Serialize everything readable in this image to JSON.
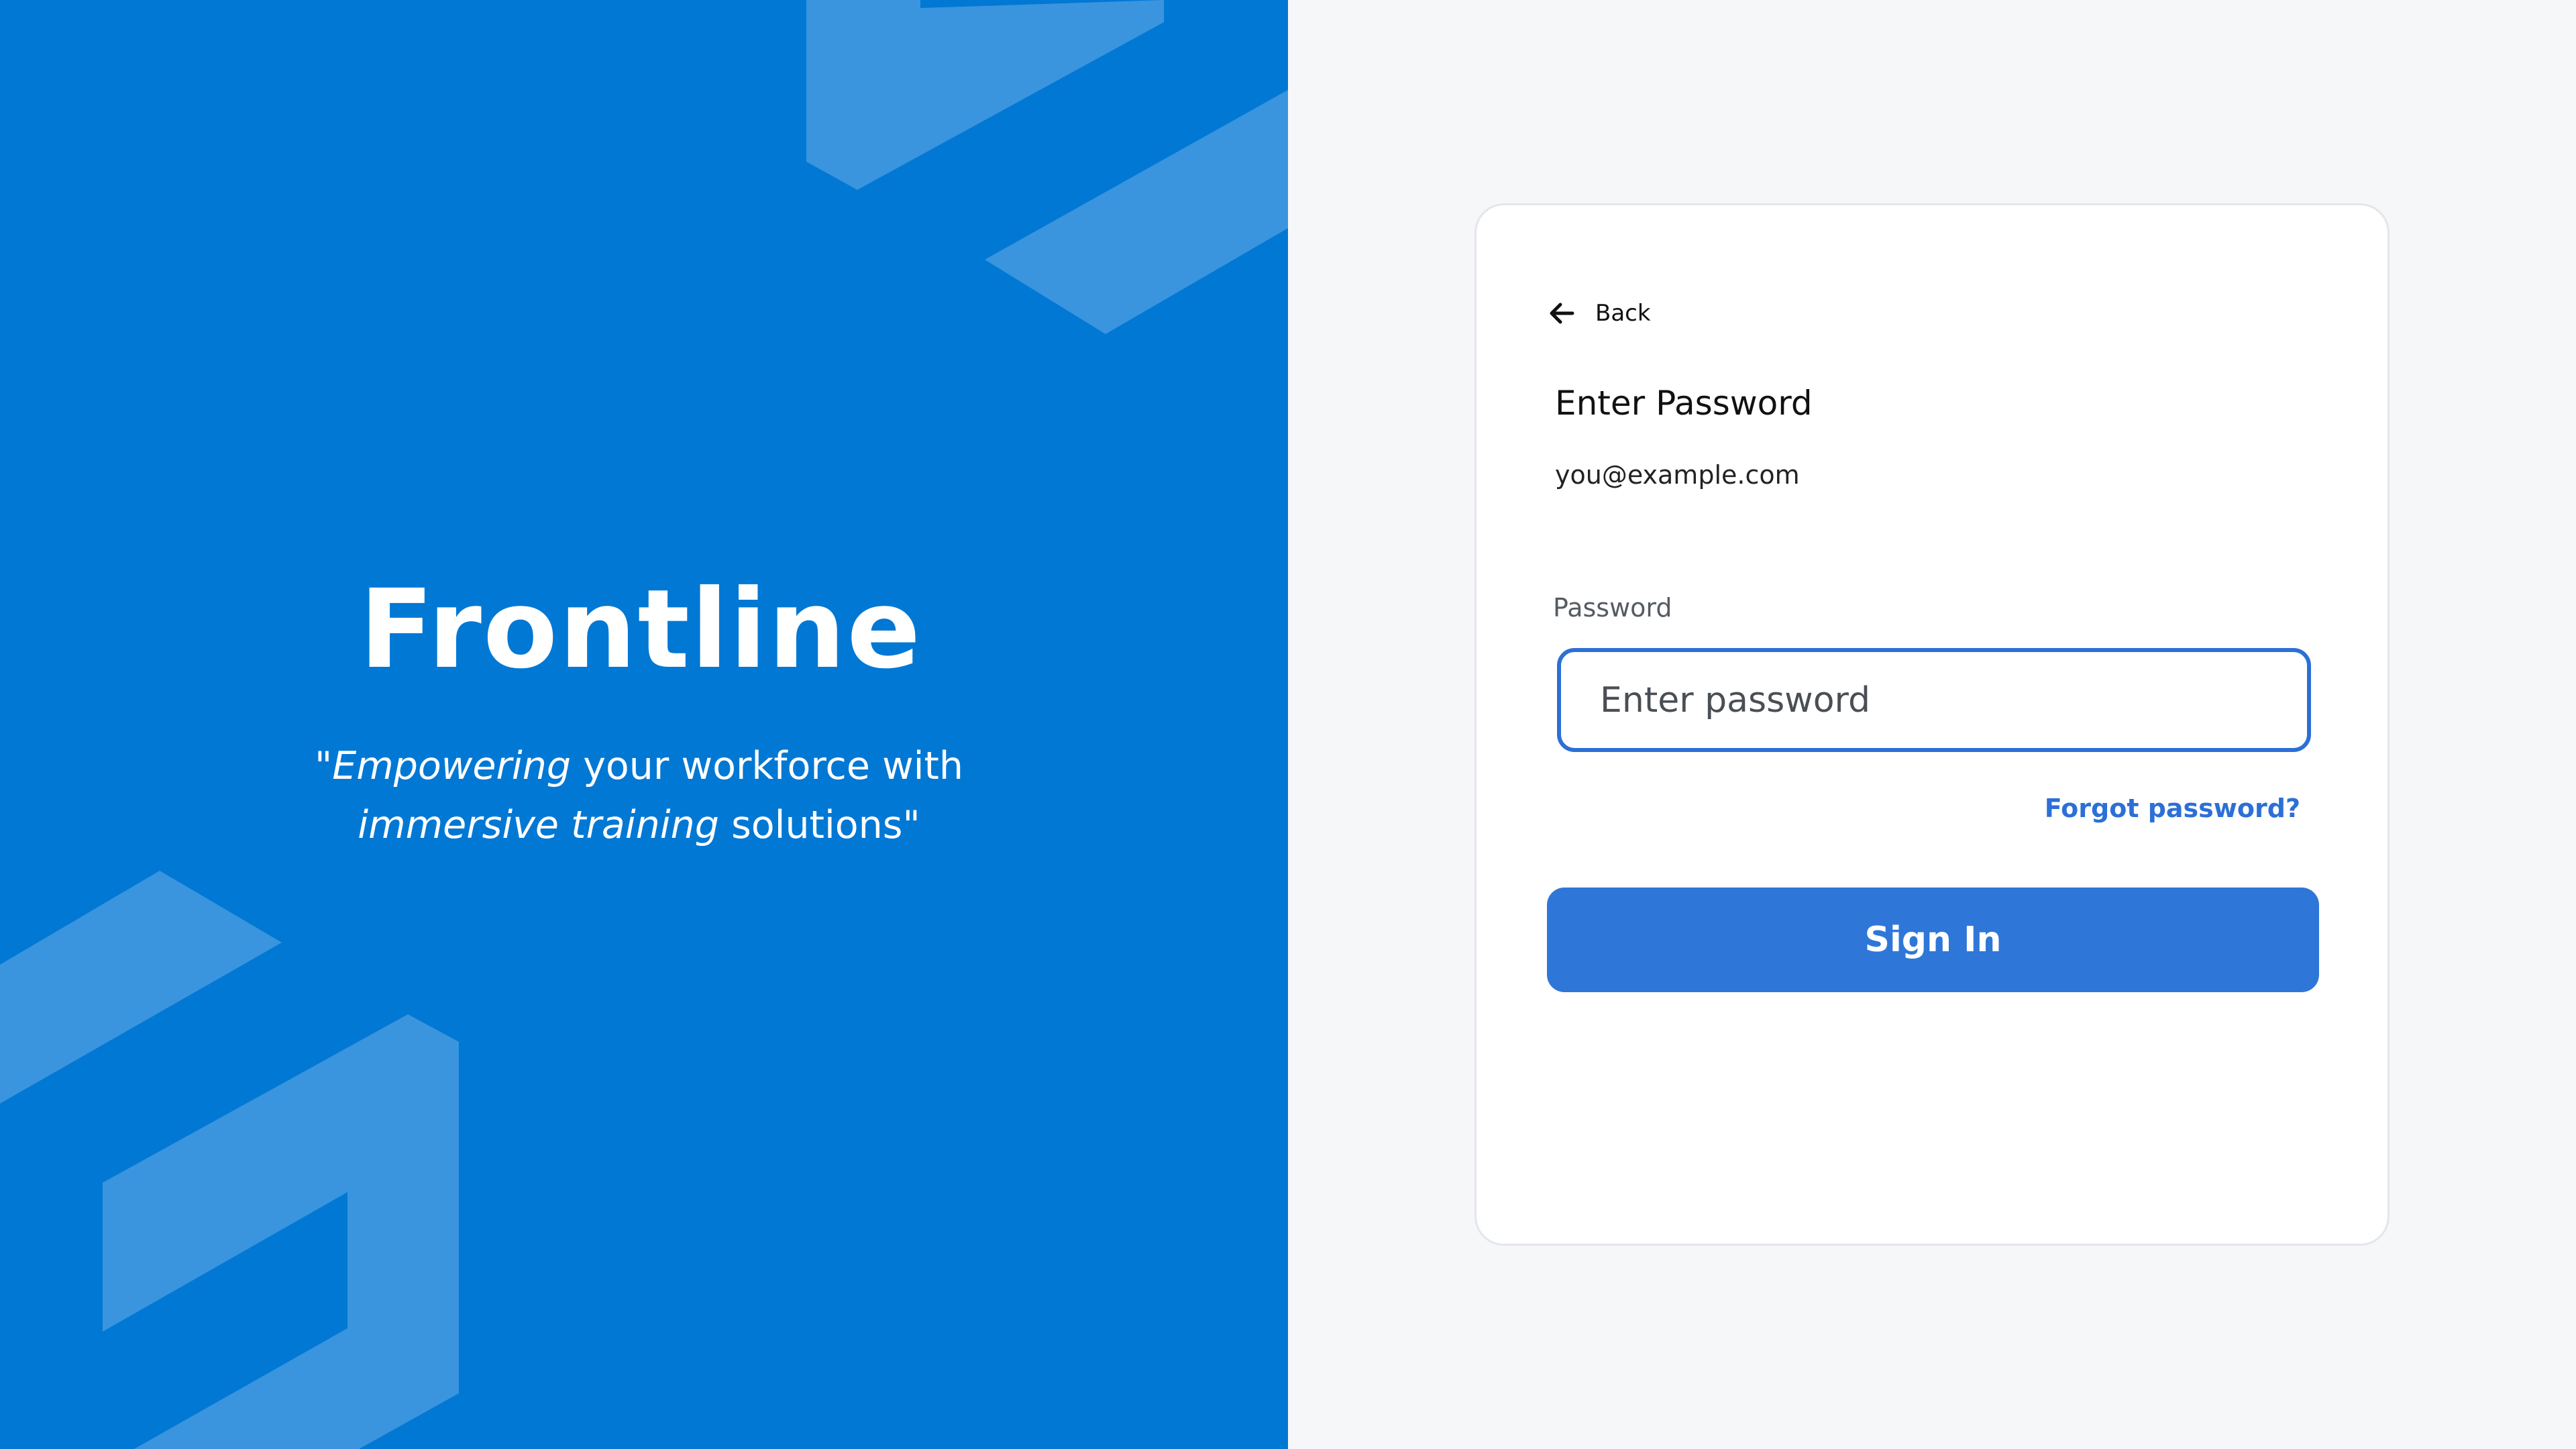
{
  "brand": {
    "name": "Frontline",
    "tagline": {
      "open_quote": "\"",
      "em_1": "Empowering",
      "text_1": " your workforce with",
      "em_2": "immersive training",
      "text_2": " solutions\""
    },
    "colors": {
      "panel": "#0278d5",
      "shape": "#3a95de"
    }
  },
  "login": {
    "back_label": "Back",
    "back_icon": "arrow-left-icon",
    "title": "Enter Password",
    "email": "you@example.com",
    "password_label": "Password",
    "password_placeholder": "Enter password",
    "password_value": "",
    "forgot_label": "Forgot password?",
    "signin_label": "Sign In",
    "colors": {
      "accent": "#2e77d8",
      "background": "#f6f7f9",
      "card": "#ffffff"
    }
  }
}
